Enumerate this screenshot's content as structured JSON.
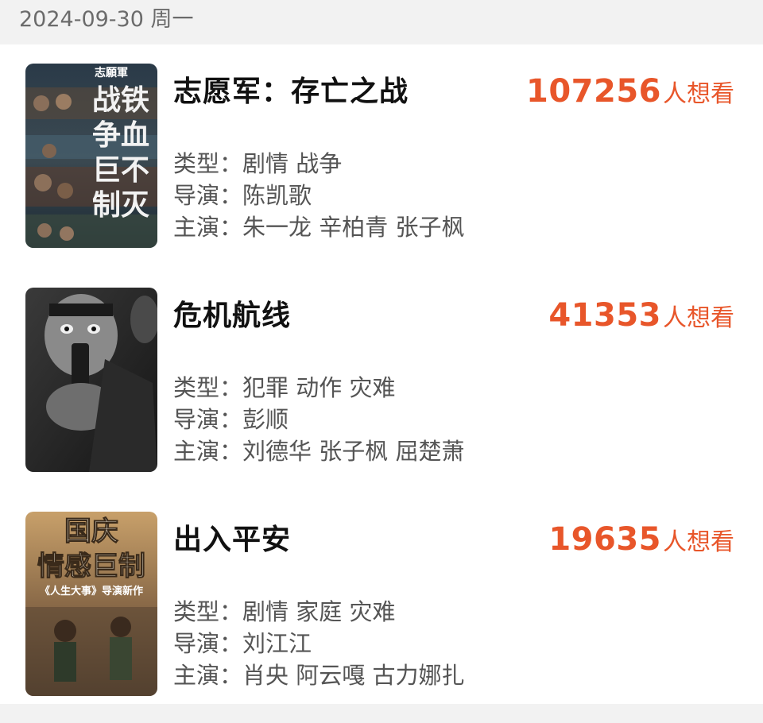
{
  "header": {
    "date": "2024-09-30 周一"
  },
  "movies": [
    {
      "title": "志愿军：存亡之战",
      "want_count": "107256",
      "want_suffix": "人想看",
      "type_label": "类型：",
      "type_value": "剧情 战争",
      "director_label": "导演：",
      "director_value": "陈凯歌",
      "cast_label": "主演：",
      "cast_value": "朱一龙 辛柏青 张子枫",
      "poster": {
        "icon": "volunteer-army-poster",
        "texts": [
          "志願軍",
          "战铁",
          "争血",
          "巨不",
          "制灭"
        ]
      }
    },
    {
      "title": "危机航线",
      "want_count": "41353",
      "want_suffix": "人想看",
      "type_label": "类型：",
      "type_value": "犯罪 动作 灾难",
      "director_label": "导演：",
      "director_value": "彭顺",
      "cast_label": "主演：",
      "cast_value": "刘德华 张子枫 屈楚萧",
      "poster": {
        "icon": "crisis-route-poster"
      }
    },
    {
      "title": "出入平安",
      "want_count": "19635",
      "want_suffix": "人想看",
      "type_label": "类型：",
      "type_value": "剧情 家庭 灾难",
      "director_label": "导演：",
      "director_value": "刘江江",
      "cast_label": "主演：",
      "cast_value": "肖央 阿云嘎 古力娜扎",
      "poster": {
        "icon": "safe-journey-poster",
        "texts": [
          "国庆",
          "情感巨制",
          "《人生大事》导演新作"
        ]
      }
    }
  ],
  "colors": {
    "accent": "#e8562a",
    "background": "#f2f2f2"
  }
}
